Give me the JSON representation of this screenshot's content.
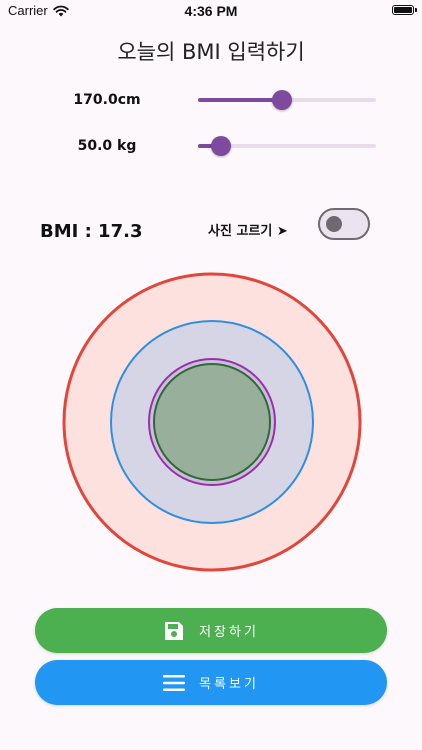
{
  "status": {
    "carrier": "Carrier",
    "time": "4:36 PM"
  },
  "title": "오늘의 BMI 입력하기",
  "height": {
    "label": "170.0cm",
    "value": 170.0,
    "fraction": 0.47
  },
  "weight": {
    "label": "50.0 kg",
    "value": 50.0,
    "fraction": 0.13
  },
  "bmi_label": "BMI : 17.3",
  "photo_toggle": {
    "label": "사진 고르기 ➤",
    "on": false
  },
  "rings": {
    "outer": "#e2463a",
    "middle": "#2e8fe0",
    "inner_ring": "#9a30a8",
    "core": "#2e6b35"
  },
  "buttons": {
    "save": "저장하기",
    "list": "목록보기"
  },
  "colors": {
    "accent": "#7e4a9d",
    "save": "#4caf50",
    "list": "#2196f3"
  }
}
